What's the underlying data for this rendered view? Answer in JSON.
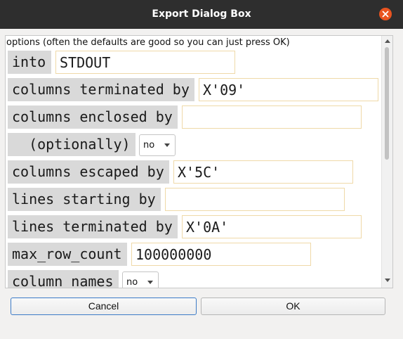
{
  "window": {
    "title": "Export Dialog Box"
  },
  "intro": "options (often the defaults are good so you can just press OK)",
  "fields": {
    "into": {
      "label": "into",
      "value": "STDOUT"
    },
    "columns_terminated_by": {
      "label": "columns terminated by",
      "value": "X'09'"
    },
    "columns_enclosed_by": {
      "label": "columns enclosed by",
      "value": ""
    },
    "optionally": {
      "label": "  (optionally)",
      "selected": "no"
    },
    "columns_escaped_by": {
      "label": "columns escaped by",
      "value": "X'5C'"
    },
    "lines_starting_by": {
      "label": "lines starting by",
      "value": ""
    },
    "lines_terminated_by": {
      "label": "lines terminated by",
      "value": "X'0A'"
    },
    "max_row_count": {
      "label": "max_row_count",
      "value": "100000000"
    },
    "column_names": {
      "label": "column_names",
      "selected": "no"
    }
  },
  "buttons": {
    "cancel": "Cancel",
    "ok": "OK"
  },
  "colors": {
    "titlebar": "#2e2e2e",
    "close": "#e95420",
    "label_bg": "#d9d9d9",
    "field_border": "#efd9a8",
    "focus": "#3c7bc7"
  }
}
